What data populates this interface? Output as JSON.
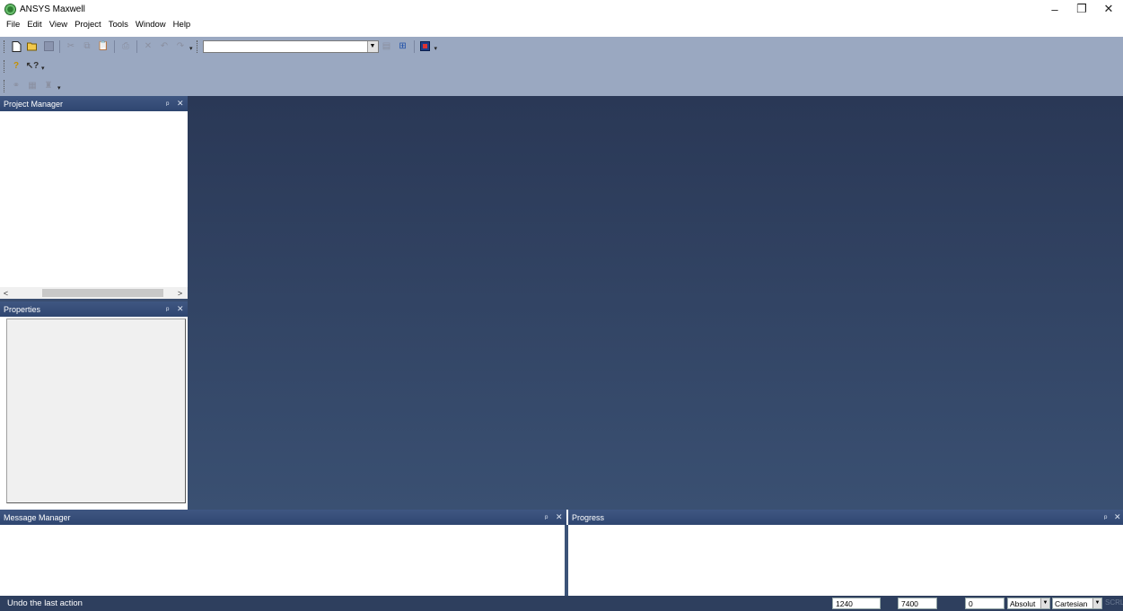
{
  "window": {
    "title": "ANSYS Maxwell",
    "controls": {
      "minimize": "–",
      "restore": "❐",
      "close": "✕"
    }
  },
  "menu": [
    "File",
    "Edit",
    "View",
    "Project",
    "Tools",
    "Window",
    "Help"
  ],
  "toolbar": {
    "row1_icons": [
      "new-icon",
      "open-icon",
      "save-icon",
      "cut-icon",
      "copy-icon",
      "paste-icon",
      "print-icon",
      "delete-icon",
      "undo-icon",
      "redo-icon"
    ],
    "combo_value": "",
    "row1_right_icons": [
      "tile-icon",
      "cascade-icon",
      "ansys-icon"
    ],
    "row2_icons": [
      "help-topics-icon",
      "whats-this-icon"
    ],
    "row3_icons": [
      "binoculars-icon",
      "grid-icon",
      "stamp-icon"
    ]
  },
  "panels": {
    "project_manager": {
      "title": "Project Manager",
      "pin": "ᵖ",
      "close": "✕",
      "scroll_left": "<",
      "scroll_right": ">"
    },
    "properties": {
      "title": "Properties",
      "pin": "ᵖ",
      "close": "✕"
    },
    "message_manager": {
      "title": "Message Manager",
      "pin": "ᵖ",
      "close": "✕"
    },
    "progress": {
      "title": "Progress",
      "pin": "ᵖ",
      "close": "✕"
    }
  },
  "status": {
    "text": "Undo the last action",
    "field1": "1240",
    "field2": "7400",
    "field3": "0",
    "mode": "Absolut",
    "coord_system": "Cartesian",
    "scrl": "SCRL"
  },
  "colors": {
    "toolbar_band": "#9aa8c1",
    "panel_header": "#2f4670",
    "workarea_top": "#2a3856",
    "workarea_bottom": "#3a5072",
    "statusbar": "#2e3f5e"
  }
}
